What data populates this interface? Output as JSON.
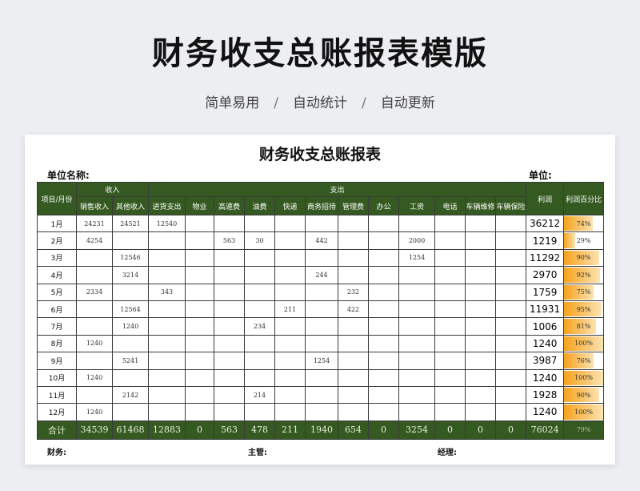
{
  "page": {
    "title": "财务收支总账报表模版",
    "tags": [
      "简单易用",
      "自动统计",
      "自动更新"
    ],
    "separator": "/"
  },
  "sheet": {
    "title": "财务收支总账报表",
    "unit_name_label": "单位名称:",
    "unit_label": "单位:",
    "header": {
      "item_month": "项目/月份",
      "income_group": "收入",
      "expense_group": "支出",
      "profit": "利润",
      "profit_pct": "利润百分比",
      "columns": [
        "销售收入",
        "其他收入",
        "进货支出",
        "物业",
        "高速费",
        "油费",
        "快递",
        "商务招待",
        "管理费",
        "办公",
        "工资",
        "电话",
        "车辆维修",
        "车辆保险"
      ]
    },
    "rows": [
      {
        "month": "1月",
        "cells": [
          "24231",
          "24521",
          "12540",
          "",
          "",
          "",
          "",
          "",
          "",
          "",
          "",
          "",
          "",
          ""
        ],
        "profit": "36212",
        "pct": "74%",
        "pct_value": 0.74
      },
      {
        "month": "2月",
        "cells": [
          "4254",
          "",
          "",
          "",
          "563",
          "30",
          "",
          "442",
          "",
          "",
          "2000",
          "",
          "",
          ""
        ],
        "profit": "1219",
        "pct": "29%",
        "pct_value": 0.29
      },
      {
        "month": "3月",
        "cells": [
          "",
          "12546",
          "",
          "",
          "",
          "",
          "",
          "",
          "",
          "",
          "1254",
          "",
          "",
          ""
        ],
        "profit": "11292",
        "pct": "90%",
        "pct_value": 0.9
      },
      {
        "month": "4月",
        "cells": [
          "",
          "3214",
          "",
          "",
          "",
          "",
          "",
          "244",
          "",
          "",
          "",
          "",
          "",
          ""
        ],
        "profit": "2970",
        "pct": "92%",
        "pct_value": 0.92
      },
      {
        "month": "5月",
        "cells": [
          "2334",
          "",
          "343",
          "",
          "",
          "",
          "",
          "",
          "232",
          "",
          "",
          "",
          "",
          ""
        ],
        "profit": "1759",
        "pct": "75%",
        "pct_value": 0.75
      },
      {
        "month": "6月",
        "cells": [
          "",
          "12564",
          "",
          "",
          "",
          "",
          "211",
          "",
          "422",
          "",
          "",
          "",
          "",
          ""
        ],
        "profit": "11931",
        "pct": "95%",
        "pct_value": 0.95
      },
      {
        "month": "7月",
        "cells": [
          "",
          "1240",
          "",
          "",
          "",
          "234",
          "",
          "",
          "",
          "",
          "",
          "",
          "",
          ""
        ],
        "profit": "1006",
        "pct": "81%",
        "pct_value": 0.81
      },
      {
        "month": "8月",
        "cells": [
          "1240",
          "",
          "",
          "",
          "",
          "",
          "",
          "",
          "",
          "",
          "",
          "",
          "",
          ""
        ],
        "profit": "1240",
        "pct": "100%",
        "pct_value": 1.0
      },
      {
        "month": "9月",
        "cells": [
          "",
          "5241",
          "",
          "",
          "",
          "",
          "",
          "1254",
          "",
          "",
          "",
          "",
          "",
          ""
        ],
        "profit": "3987",
        "pct": "76%",
        "pct_value": 0.76
      },
      {
        "month": "10月",
        "cells": [
          "1240",
          "",
          "",
          "",
          "",
          "",
          "",
          "",
          "",
          "",
          "",
          "",
          "",
          ""
        ],
        "profit": "1240",
        "pct": "100%",
        "pct_value": 1.0
      },
      {
        "month": "11月",
        "cells": [
          "",
          "2142",
          "",
          "",
          "",
          "214",
          "",
          "",
          "",
          "",
          "",
          "",
          "",
          ""
        ],
        "profit": "1928",
        "pct": "90%",
        "pct_value": 0.9
      },
      {
        "month": "12月",
        "cells": [
          "1240",
          "",
          "",
          "",
          "",
          "",
          "",
          "",
          "",
          "",
          "",
          "",
          "",
          ""
        ],
        "profit": "1240",
        "pct": "100%",
        "pct_value": 1.0
      }
    ],
    "total": {
      "label": "合计",
      "cells": [
        "34539",
        "61468",
        "12883",
        "0",
        "563",
        "478",
        "211",
        "1940",
        "654",
        "0",
        "3254",
        "0",
        "0",
        "0"
      ],
      "profit": "76024",
      "pct": "79%"
    },
    "footer": {
      "finance": "财务:",
      "supervisor": "主管:",
      "manager": "经理:"
    }
  }
}
